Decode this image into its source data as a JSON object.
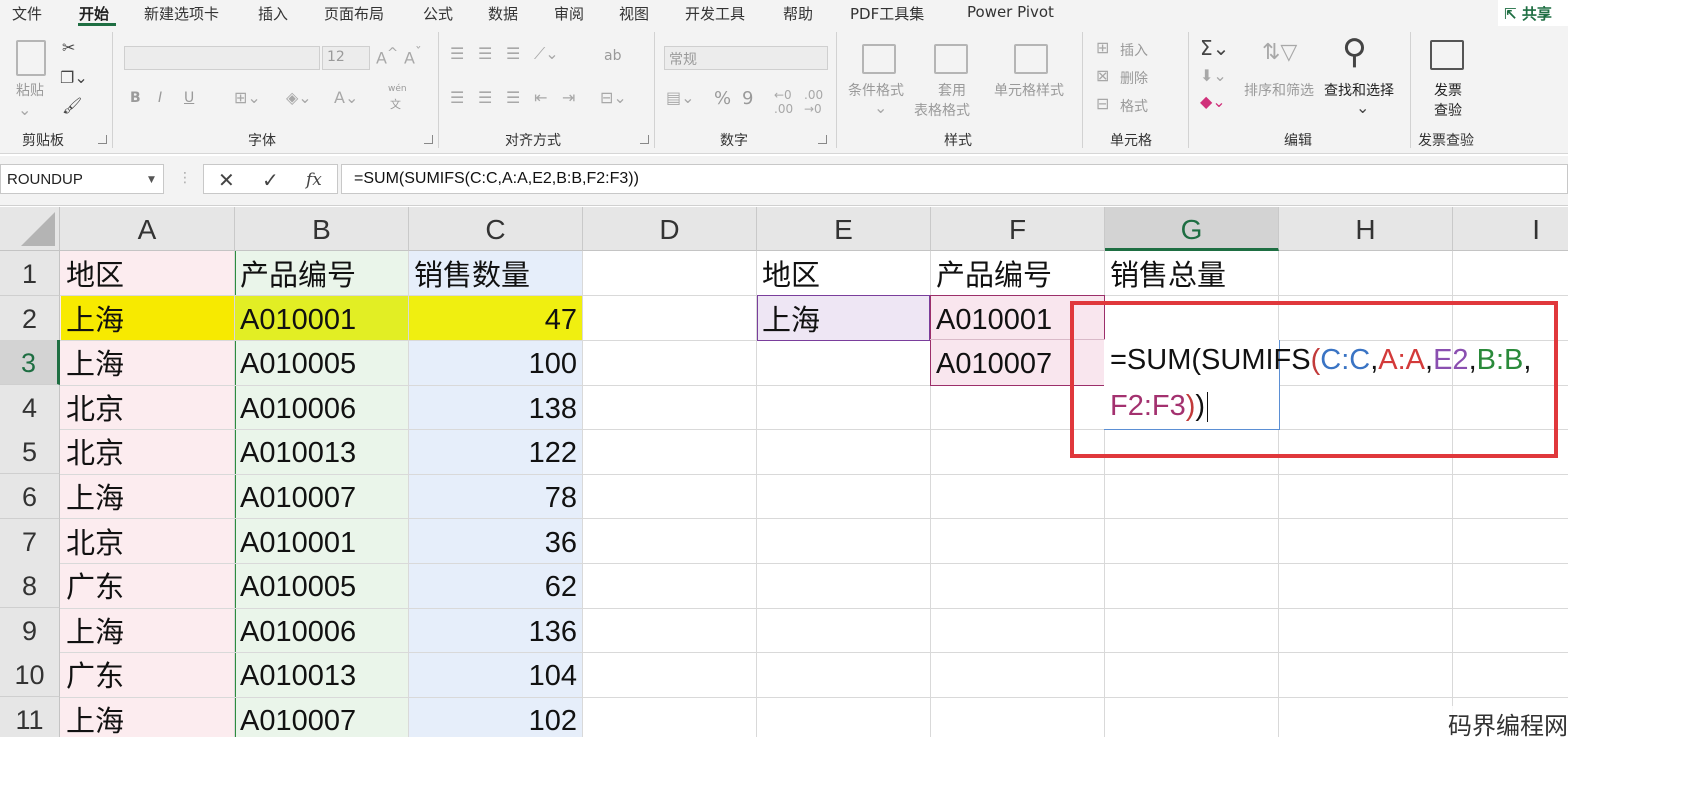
{
  "menu": {
    "tabs": [
      "文件",
      "开始",
      "新建选项卡",
      "插入",
      "页面布局",
      "公式",
      "数据",
      "审阅",
      "视图",
      "开发工具",
      "帮助",
      "PDF工具集",
      "Power Pivot"
    ],
    "active": "开始",
    "share": "共享"
  },
  "ribbon": {
    "clipboard": {
      "paste": "粘贴",
      "label": "剪贴板"
    },
    "font": {
      "size": "12",
      "wen": "wén",
      "wen_char": "文",
      "bold": "B",
      "italic": "I",
      "underline": "U",
      "label": "字体"
    },
    "alignment": {
      "wrap": "ab",
      "label": "对齐方式"
    },
    "number": {
      "format": "常规",
      "percent": "%",
      "comma": "9",
      "label": "数字"
    },
    "styles": {
      "conditional": "条件格式",
      "table_l1": "套用",
      "table_l2": "表格格式",
      "cell_styles": "单元格样式",
      "label": "样式"
    },
    "cells": {
      "insert": "插入",
      "delete": "删除",
      "format": "格式",
      "label": "单元格"
    },
    "editing": {
      "sort": "排序和筛选",
      "find": "查找和选择",
      "label": "编辑"
    },
    "invoice": {
      "btn_l1": "发票",
      "btn_l2": "查验",
      "label": "发票查验"
    }
  },
  "formula_bar": {
    "name_box": "ROUNDUP",
    "cancel": "✕",
    "enter": "✓",
    "fx": "fx",
    "formula": "=SUM(SUMIFS(C:C,A:A,E2,B:B,F2:F3))"
  },
  "grid": {
    "columns": [
      "A",
      "B",
      "C",
      "D",
      "E",
      "F",
      "G",
      "H",
      "I"
    ],
    "selected_column": "G",
    "rows": [
      "1",
      "2",
      "3",
      "4",
      "5",
      "6",
      "7",
      "8",
      "9",
      "10",
      "11"
    ],
    "selected_row": "3",
    "table_main": {
      "headers": [
        "地区",
        "产品编号",
        "销售数量"
      ],
      "rows": [
        [
          "上海",
          "A010001",
          "47"
        ],
        [
          "上海",
          "A010005",
          "100"
        ],
        [
          "北京",
          "A010006",
          "138"
        ],
        [
          "北京",
          "A010013",
          "122"
        ],
        [
          "上海",
          "A010007",
          "78"
        ],
        [
          "北京",
          "A010001",
          "36"
        ],
        [
          "广东",
          "A010005",
          "62"
        ],
        [
          "上海",
          "A010006",
          "136"
        ],
        [
          "广东",
          "A010013",
          "104"
        ],
        [
          "上海",
          "A010007",
          "102"
        ]
      ]
    },
    "criteria": {
      "headers": [
        "地区",
        "产品编号",
        "销售总量"
      ],
      "e2": "上海",
      "f2": "A010001",
      "f3": "A010007"
    },
    "edit_line1": [
      "=SUM(SUMIFS",
      "(",
      "C:C",
      ",",
      "A:A",
      ",",
      "E2",
      ",",
      "B:B",
      ","
    ],
    "edit_line2": [
      "F2:F3",
      ")",
      ")"
    ]
  },
  "watermark": "码界编程网",
  "colors": {
    "accent": "#1e6e42",
    "callout": "#e0383c",
    "highlight": "#f7ea00"
  }
}
